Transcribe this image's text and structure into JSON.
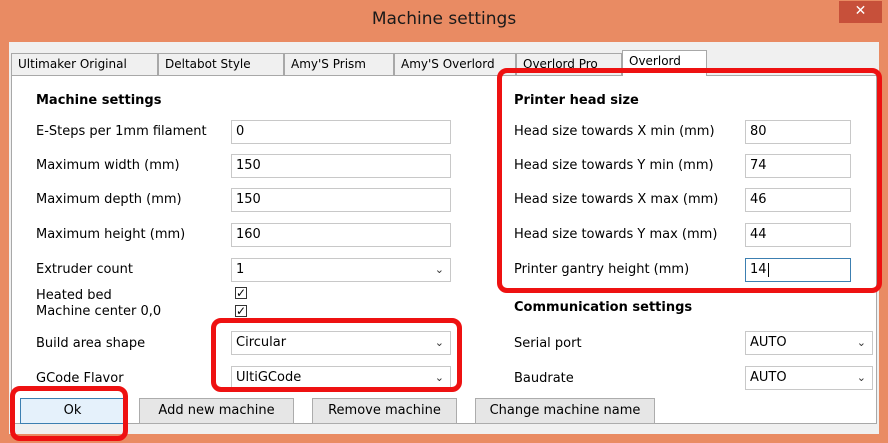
{
  "window": {
    "title": "Machine settings",
    "close_glyph": "✕"
  },
  "tabs": [
    "Ultimaker Original",
    "Deltabot Style",
    "Amy'S Prism",
    "Amy'S Overlord",
    "Overlord Pro",
    "Overlord"
  ],
  "machine": {
    "heading": "Machine settings",
    "esteps_label": "E-Steps per 1mm filament",
    "esteps_value": "0",
    "width_label": "Maximum width (mm)",
    "width_value": "150",
    "depth_label": "Maximum depth (mm)",
    "depth_value": "150",
    "height_label": "Maximum height (mm)",
    "height_value": "160",
    "extruder_label": "Extruder count",
    "extruder_value": "1",
    "heated_label": "Heated bed",
    "center_label": "Machine center 0,0",
    "shape_label": "Build area shape",
    "shape_value": "Circular",
    "flavor_label": "GCode Flavor",
    "flavor_value": "UltiGCode"
  },
  "head": {
    "heading": "Printer head size",
    "xmin_label": "Head size towards X min (mm)",
    "xmin_value": "80",
    "ymin_label": "Head size towards Y min (mm)",
    "ymin_value": "74",
    "xmax_label": "Head size towards X max (mm)",
    "xmax_value": "46",
    "ymax_label": "Head size towards Y max (mm)",
    "ymax_value": "44",
    "gantry_label": "Printer gantry height (mm)",
    "gantry_value": "14"
  },
  "comm": {
    "heading": "Communication settings",
    "port_label": "Serial port",
    "port_value": "AUTO",
    "baud_label": "Baudrate",
    "baud_value": "AUTO"
  },
  "buttons": {
    "ok": "Ok",
    "add": "Add new machine",
    "remove": "Remove machine",
    "rename": "Change machine name"
  },
  "colors": {
    "title_bar": "#e98b63",
    "close_button": "#c7503a",
    "highlight": "#ee1111",
    "focus": "#3c7fb1"
  },
  "checked": {
    "heated_bed": true,
    "machine_center": true
  }
}
